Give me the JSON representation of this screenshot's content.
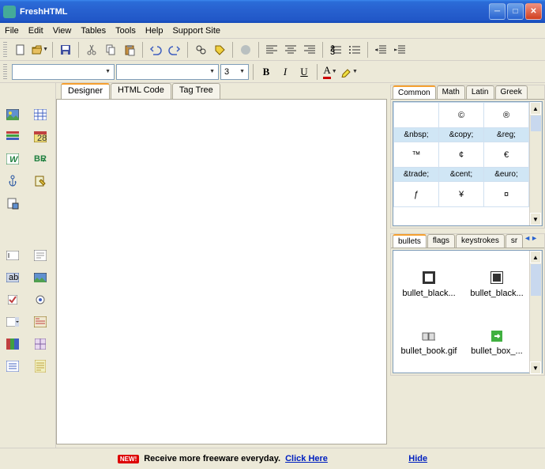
{
  "window": {
    "title": "FreshHTML"
  },
  "menus": [
    "File",
    "Edit",
    "View",
    "Tables",
    "Tools",
    "Help",
    "Support Site"
  ],
  "toolbar2": {
    "font_size": "3"
  },
  "main_tabs": [
    "Designer",
    "HTML Code",
    "Tag Tree"
  ],
  "char_panel": {
    "tabs": [
      "Common",
      "Math",
      "Latin",
      "Greek"
    ],
    "rows": [
      {
        "symbols": [
          "",
          "©",
          "®"
        ],
        "labels": [
          "&nbsp;",
          "&copy;",
          "&reg;"
        ]
      },
      {
        "symbols": [
          "™",
          "¢",
          "€"
        ],
        "labels": [
          "&trade;",
          "&cent;",
          "&euro;"
        ]
      },
      {
        "symbols": [
          "ƒ",
          "¥",
          "¤"
        ],
        "labels": [
          "",
          "",
          ""
        ]
      }
    ]
  },
  "items_panel": {
    "tabs": [
      "bullets",
      "flags",
      "keystrokes",
      "sr"
    ],
    "items": [
      "bullet_black...",
      "bullet_black...",
      "bullet_book.gif",
      "bullet_box_..."
    ]
  },
  "footer": {
    "badge": "NEW!",
    "text": "Receive more freeware everyday.",
    "link1": "Click Here",
    "link2": "Hide"
  }
}
